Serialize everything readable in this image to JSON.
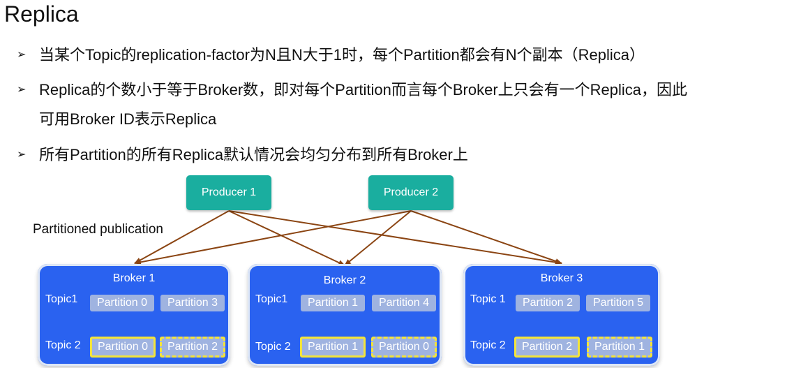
{
  "title": "Replica",
  "bullets": [
    {
      "lines": [
        "当某个Topic的replication-factor为N且N大于1时，每个Partition都会有N个副本（Replica）"
      ]
    },
    {
      "lines": [
        "Replica的个数小于等于Broker数，即对每个Partition而言每个Broker上只会有一个Replica，因此",
        "可用Broker ID表示Replica"
      ]
    },
    {
      "lines": [
        "所有Partition的所有Replica默认情况会均匀分布到所有Broker上"
      ]
    }
  ],
  "bullet_marker": "➢",
  "diagram": {
    "producers": [
      "Producer 1",
      "Producer 2"
    ],
    "label": "Partitioned publication",
    "brokers": [
      {
        "name": "Broker 1",
        "topic1_label": "Topic1",
        "topic2_label": "Topic 2",
        "topic1_parts": [
          "Partition 0",
          "Partition 3"
        ],
        "topic2_parts": [
          "Partition 0",
          "Partition 2"
        ]
      },
      {
        "name": "Broker 2",
        "topic1_label": "Topic1",
        "topic2_label": "Topic 2",
        "topic1_parts": [
          "Partition 1",
          "Partition 4"
        ],
        "topic2_parts": [
          "Partition 1",
          "Partition 0"
        ]
      },
      {
        "name": "Broker 3",
        "topic1_label": "Topic 1",
        "topic2_label": "Topic 2",
        "topic1_parts": [
          "Partition 2",
          "Partition 5"
        ],
        "topic2_parts": [
          "Partition 2",
          "Partition 1"
        ]
      }
    ],
    "colors": {
      "producer": "#1aae9f",
      "broker": "#2a62f0",
      "partition": "#9fb3e0",
      "replica_border": "#f3e43a",
      "arrow": "#8b4513"
    }
  }
}
